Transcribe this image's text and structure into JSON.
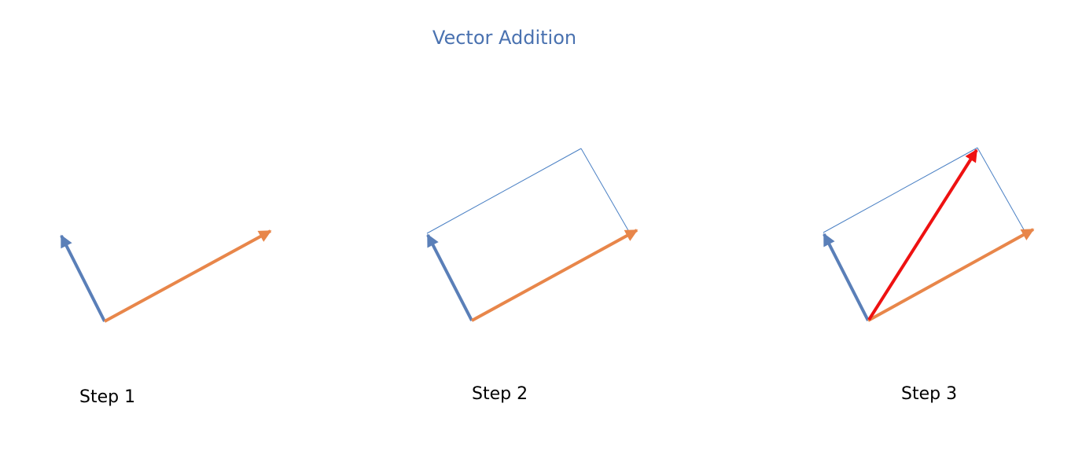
{
  "title": "Vector Addition",
  "colors": {
    "title": "#4a72b0",
    "vector_a": "#5a7fb8",
    "vector_b": "#e8864a",
    "resultant": "#ee1111",
    "parallelogram": "#4a80c4"
  },
  "steps": [
    {
      "label": "Step 1"
    },
    {
      "label": "Step 2"
    },
    {
      "label": "Step 3"
    }
  ]
}
